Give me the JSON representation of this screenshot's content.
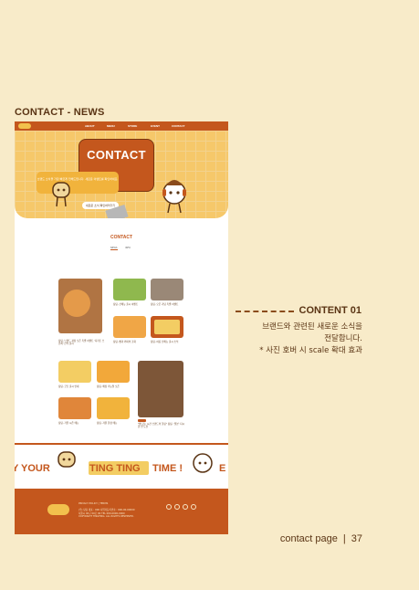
{
  "page": {
    "section_title": "CONTACT - NEWS",
    "footer_label": "contact page",
    "footer_sep": "|",
    "page_number": "37"
  },
  "side": {
    "title": "CONTENT 01",
    "desc_line1": "브랜드와 관련된 새로운 소식을",
    "desc_line2": "전달합니다.",
    "desc_line3": "* 사진 호버 시 scale 확대 효과"
  },
  "mock": {
    "nav": [
      "ABOUT",
      "MENU",
      "STORE",
      "EVENT",
      "CONTACT"
    ],
    "hero_title": "CONTACT",
    "hero_sub": "브랜드 소식을 가장 빠르게 전해드립니다. 새로운 이벤트를 확인하세요.",
    "hero_pill": "새로운 소식 확인하러가기",
    "content_head": "CONTACT",
    "tabs": [
      "NEWS",
      "INFO"
    ],
    "cards": [
      "팅팅, 브랜드 광장 오픈 특별 이벤트 '디저트 브런치' 신작 출시",
      "팅팅, 신메뉴 출시 이벤트",
      "팅팅, 오픈 기념 특별 이벤트",
      "팅팅, 빵과 커피의 조화",
      "팅팅, 여름 신메뉴 출시 소식",
      "팅팅, 굿즈 출시 안내",
      "팅팅, 매장 리뉴얼 오픈",
      "팅팅, 가을 시즌 메뉴",
      "팅팅, 겨울 한정 메뉴",
      "\"빵 굽는 시간 브랜드의 힐링\" 팅팅, '일본' 다시 한 번 도전"
    ],
    "banner_your": "Y YOUR",
    "banner_ting": "TING TING",
    "banner_time": "TIME !",
    "banner_e": "E",
    "footer_lines": [
      "PRIVACY POLICY  |  TERMS",
      "(주) 팅팅  대표 : 000  사업자등록번호 : 000-00-00000",
      "서울시 00구 00로 00  TEL 000-0000-0000",
      "COPYRIGHT TINGTING. ALL RIGHTS RESERVED."
    ]
  },
  "colors": {
    "accent": "#c4571d",
    "background": "#f8ebc9",
    "hero": "#f6c86a"
  }
}
